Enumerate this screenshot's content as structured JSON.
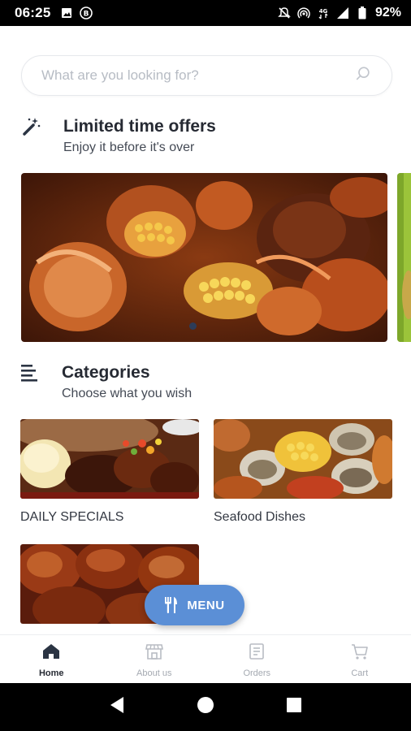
{
  "status_bar": {
    "time": "06:25",
    "battery": "92%",
    "network": "4G"
  },
  "search": {
    "placeholder": "What are you looking for?"
  },
  "offers": {
    "title": "Limited time offers",
    "subtitle": "Enjoy it before it's over"
  },
  "categories": {
    "title": "Categories",
    "subtitle": "Choose what you wish",
    "items": [
      {
        "label": "DAILY SPECIALS"
      },
      {
        "label": "Seafood Dishes"
      },
      {
        "label": ""
      }
    ]
  },
  "menu_button": {
    "label": "MENU"
  },
  "bottom_nav": {
    "items": [
      {
        "label": "Home",
        "icon": "home-icon",
        "active": true
      },
      {
        "label": "About us",
        "icon": "store-icon",
        "active": false
      },
      {
        "label": "Orders",
        "icon": "orders-icon",
        "active": false
      },
      {
        "label": "Cart",
        "icon": "cart-icon",
        "active": false
      }
    ]
  },
  "colors": {
    "accent": "#5b8fd6",
    "title": "#262a33",
    "nav_inactive": "#a4a9b1"
  }
}
